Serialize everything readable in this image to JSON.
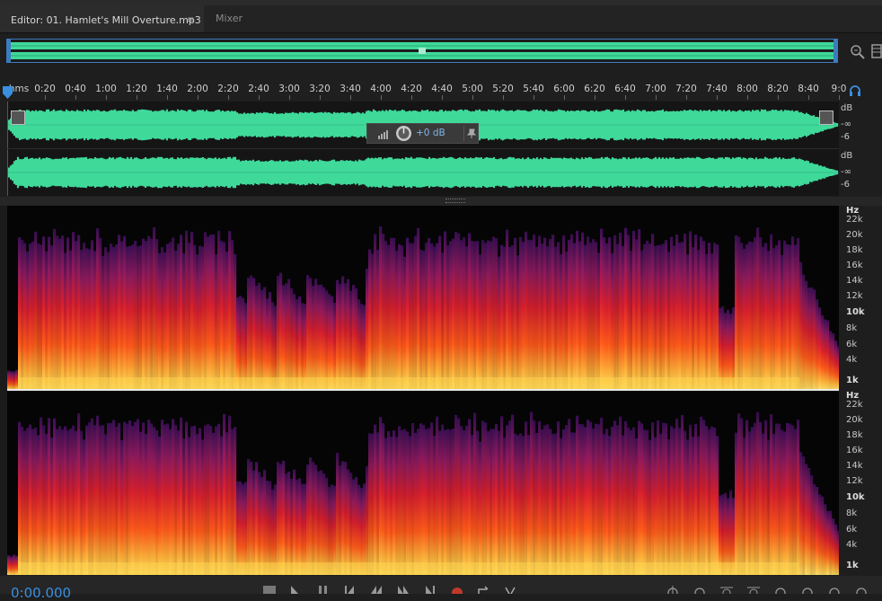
{
  "tabs": {
    "editor_label": "Editor: 01. Hamlet's Mill Overture.mp3",
    "editor_menu": "≡",
    "mixer_label": "Mixer"
  },
  "ruler": {
    "unit": "hms",
    "ticks": [
      "0:20",
      "0:40",
      "1:00",
      "1:20",
      "1:40",
      "2:00",
      "2:20",
      "2:40",
      "3:00",
      "3:20",
      "3:40",
      "4:00",
      "4:20",
      "4:40",
      "5:00",
      "5:20",
      "5:40",
      "6:00",
      "6:20",
      "6:40",
      "7:00",
      "7:20",
      "7:40",
      "8:00",
      "8:20",
      "8:40",
      "9:0"
    ]
  },
  "waveform": {
    "color": "#3fd99a",
    "db_labels": [
      "dB",
      "-∞",
      "-6"
    ]
  },
  "hud": {
    "gain": "+0 dB"
  },
  "spectral": {
    "hz_labels": [
      "Hz",
      "22k",
      "20k",
      "18k",
      "16k",
      "14k",
      "12k",
      "10k",
      "8k",
      "6k",
      "4k",
      "1k"
    ]
  },
  "transport": {
    "timecode": "0:00.000"
  },
  "icons": {
    "zoom": "zoom-icon",
    "panel": "panel-icon",
    "headphones": "headphones-icon",
    "pin": "pin-icon",
    "volume_knob": "volume-knob-icon",
    "meter": "meter-icon"
  },
  "colors": {
    "accent_blue": "#3a8fe0",
    "waveform_green": "#3fd99a",
    "record_red": "#c0392b"
  }
}
